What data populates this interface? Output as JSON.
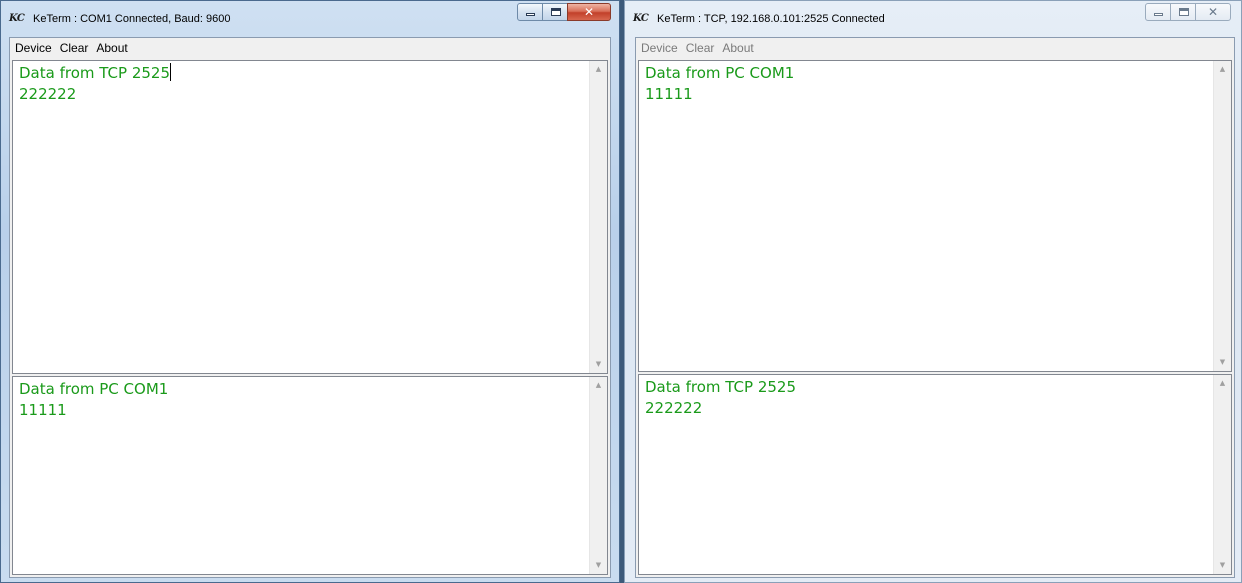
{
  "windows": [
    {
      "logo": "KC",
      "title": "KeTerm : COM1 Connected, Baud: 9600",
      "active": true,
      "menu": [
        "Device",
        "Clear",
        "About"
      ],
      "receive_pane": {
        "lines": [
          "Data from TCP 2525",
          "222222"
        ]
      },
      "send_pane": {
        "lines": [
          "Data from PC COM1",
          "11111"
        ]
      }
    },
    {
      "logo": "KC",
      "title": "KeTerm : TCP, 192.168.0.101:2525 Connected",
      "active": false,
      "menu": [
        "Device",
        "Clear",
        "About"
      ],
      "receive_pane": {
        "lines": [
          "Data from PC COM1",
          "11111"
        ]
      },
      "send_pane": {
        "lines": [
          "Data from TCP 2525",
          "222222"
        ]
      }
    }
  ],
  "caption_glyphs": {
    "close": "✕"
  },
  "scroll_glyphs": {
    "up": "▲",
    "down": "▼"
  },
  "colors": {
    "terminal_text": "#1a9a1a",
    "active_frame": "#b9d0ea",
    "inactive_frame": "#dbe5f1",
    "close_button_active": "#c2402a"
  }
}
